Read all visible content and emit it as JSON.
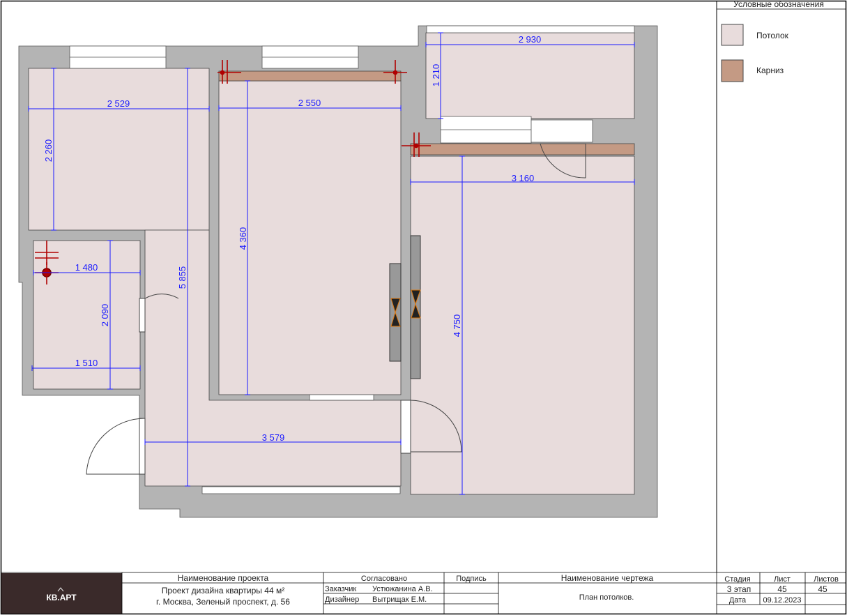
{
  "legend": {
    "title": "Условные обозначения",
    "items": [
      {
        "label": "Потолок",
        "color": "#e8dcdc"
      },
      {
        "label": "Карниз",
        "color": "#c49a84"
      }
    ]
  },
  "dimensions": {
    "d2529": "2 529",
    "d2260": "2 260",
    "d2550": "2 550",
    "d4360": "4 360",
    "d5855": "5 855",
    "d2930": "2 930",
    "d1210": "1 210",
    "d3160": "3 160",
    "d4750": "4 750",
    "d1480": "1 480",
    "d2090": "2 090",
    "d1510": "1 510",
    "d3579": "3 579"
  },
  "titleblock": {
    "logo_text": "КВ.АРТ",
    "project_name_header": "Наименование проекта",
    "project_line1": "Проект дизайна квартиры 44 м²",
    "project_line2": "г. Москва, Зеленый проспект, д. 56",
    "agreed_header": "Согласовано",
    "sign_header": "Подпись",
    "customer_label": "Заказчик",
    "customer_name": "Устюжанина А.В.",
    "designer_label": "Дизайнер",
    "designer_name": "Вытрищак Е.М.",
    "drawing_name_header": "Наименование чертежа",
    "drawing_name": "План потолков.",
    "stage_header": "Стадия",
    "sheet_header": "Лист",
    "sheets_header": "Листов",
    "stage": "3 этап",
    "sheet": "45",
    "sheets": "45",
    "date_label": "Дата",
    "date": "09.12.2023"
  },
  "colors": {
    "wall": "#b4b4b4",
    "ceiling": "#e8dcdc",
    "cornice": "#c49a84",
    "dimension": "#1a1aff",
    "marker": "#b00000",
    "titleblock_logo_bg": "#3a2a2a"
  }
}
